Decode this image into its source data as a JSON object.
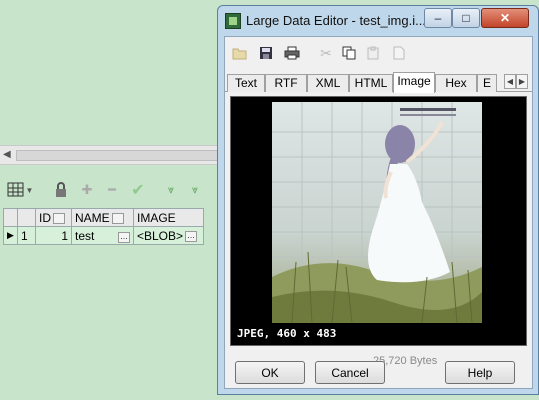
{
  "background_app": {
    "toolbar": {
      "grid_icon": "grid-icon",
      "lock_icon": "lock-icon",
      "add_icon": "plus-icon",
      "remove_icon": "minus-icon",
      "post_icon": "check-icon",
      "filter_icons": [
        "filter-down-icon",
        "filter-down-icon"
      ]
    },
    "grid": {
      "columns": [
        "ID",
        "NAME",
        "IMAGE"
      ],
      "rows": [
        {
          "row_no": "1",
          "id": "1",
          "name": "test",
          "image": "<BLOB>"
        }
      ]
    }
  },
  "dialog": {
    "title": "Large Data Editor - test_img.i...",
    "window_buttons": {
      "minimize": "–",
      "maximize": "□",
      "close": "✕"
    },
    "toolbar_icons": [
      "open-folder-icon",
      "save-icon",
      "print-icon",
      "cut-icon",
      "copy-icon",
      "paste-icon",
      "clear-icon"
    ],
    "tabs": [
      "Text",
      "RTF",
      "XML",
      "HTML",
      "Image",
      "Hex",
      "E"
    ],
    "active_tab": "Image",
    "image_caption": "JPEG, 460 x 483",
    "byte_count": "25,720 Bytes",
    "buttons": {
      "ok": "OK",
      "cancel": "Cancel",
      "help": "Help"
    }
  },
  "colors": {
    "desktop": "#c8e5cc",
    "window_frame": "#bfd7ea",
    "close_button": "#c1442a"
  }
}
